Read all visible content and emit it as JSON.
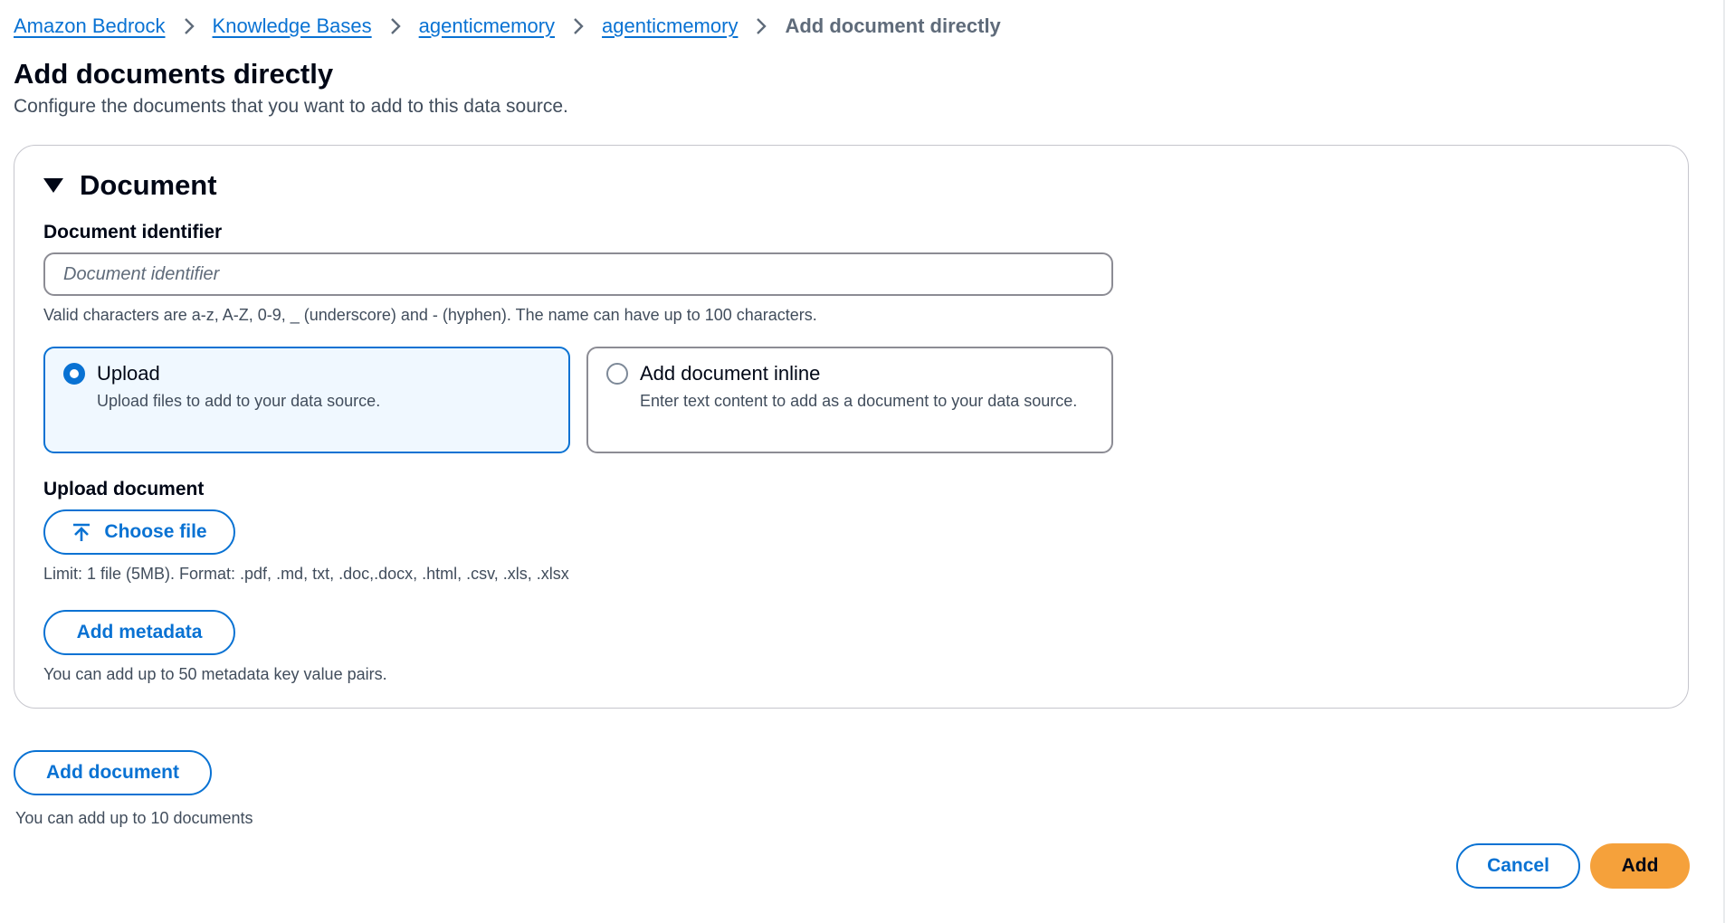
{
  "breadcrumb": {
    "items": [
      {
        "label": "Amazon Bedrock"
      },
      {
        "label": "Knowledge Bases"
      },
      {
        "label": "agenticmemory"
      },
      {
        "label": "agenticmemory"
      }
    ],
    "current": "Add document directly"
  },
  "page": {
    "title": "Add documents directly",
    "description": "Configure the documents that you want to add to this data source."
  },
  "document_section": {
    "title": "Document",
    "identifier": {
      "label": "Document identifier",
      "placeholder": "Document identifier",
      "value": "",
      "hint": "Valid characters are a-z, A-Z, 0-9, _ (underscore) and - (hyphen). The name can have up to 100 characters."
    },
    "source_options": [
      {
        "title": "Upload",
        "description": "Upload files to add to your data source.",
        "selected": true
      },
      {
        "title": "Add document inline",
        "description": "Enter text content to add as a document to your data source.",
        "selected": false
      }
    ],
    "upload": {
      "label": "Upload document",
      "choose_file_label": "Choose file",
      "hint": "Limit: 1 file (5MB). Format: .pdf, .md, txt, .doc,.docx, .html, .csv, .xls, .xlsx"
    },
    "metadata": {
      "button_label": "Add metadata",
      "hint": "You can add up to 50 metadata key value pairs."
    }
  },
  "add_document": {
    "button_label": "Add document",
    "hint": "You can add up to 10 documents"
  },
  "footer": {
    "cancel_label": "Cancel",
    "add_label": "Add"
  },
  "colors": {
    "link": "#0972d3",
    "primary_button": "#f5a13b",
    "selected_tile_bg": "#f0f8ff",
    "border": "#8c8c94"
  },
  "icons": {
    "breadcrumb_separator": "chevron-right-icon",
    "section_toggle": "caret-down-icon",
    "upload": "upload-icon"
  }
}
